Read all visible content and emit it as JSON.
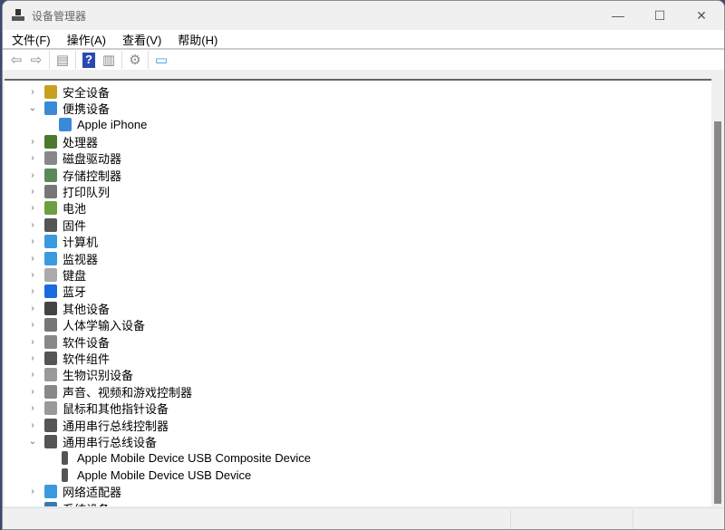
{
  "window": {
    "title": "设备管理器",
    "minimize": "—",
    "maximize": "☐",
    "close": "✕"
  },
  "menu": [
    "文件(F)",
    "操作(A)",
    "查看(V)",
    "帮助(H)"
  ],
  "toolbar": [
    {
      "icon": "back-icon",
      "glyph": "⇦"
    },
    {
      "icon": "forward-icon",
      "glyph": "⇨"
    },
    {
      "icon": "show-hide-console-tree-icon",
      "glyph": "▤"
    },
    {
      "icon": "help-icon",
      "glyph": "?"
    },
    {
      "icon": "properties-pane-icon",
      "glyph": "▥"
    },
    {
      "icon": "update-driver-icon",
      "glyph": "⚙"
    },
    {
      "icon": "scan-hardware-icon",
      "glyph": "▭"
    }
  ],
  "tree": [
    {
      "label": "安全设备",
      "level": 0,
      "expanded": false,
      "color": "#c8a020"
    },
    {
      "label": "便携设备",
      "level": 0,
      "expanded": true,
      "color": "#3a8ad8"
    },
    {
      "label": "Apple iPhone",
      "level": 1,
      "color": "#3a8ad8"
    },
    {
      "label": "处理器",
      "level": 0,
      "expanded": false,
      "color": "#4a7a2a"
    },
    {
      "label": "磁盘驱动器",
      "level": 0,
      "expanded": false,
      "color": "#888888"
    },
    {
      "label": "存储控制器",
      "level": 0,
      "expanded": false,
      "color": "#5a8a5a"
    },
    {
      "label": "打印队列",
      "level": 0,
      "expanded": false,
      "color": "#777777"
    },
    {
      "label": "电池",
      "level": 0,
      "expanded": false,
      "color": "#6aa040"
    },
    {
      "label": "固件",
      "level": 0,
      "expanded": false,
      "color": "#555555"
    },
    {
      "label": "计算机",
      "level": 0,
      "expanded": false,
      "color": "#3a9ae0"
    },
    {
      "label": "监视器",
      "level": 0,
      "expanded": false,
      "color": "#3a9ae0"
    },
    {
      "label": "键盘",
      "level": 0,
      "expanded": false,
      "color": "#aaaaaa"
    },
    {
      "label": "蓝牙",
      "level": 0,
      "expanded": false,
      "color": "#1a6ae0"
    },
    {
      "label": "其他设备",
      "level": 0,
      "expanded": false,
      "color": "#444444"
    },
    {
      "label": "人体学输入设备",
      "level": 0,
      "expanded": false,
      "color": "#777777"
    },
    {
      "label": "软件设备",
      "level": 0,
      "expanded": false,
      "color": "#888888"
    },
    {
      "label": "软件组件",
      "level": 0,
      "expanded": false,
      "color": "#555555"
    },
    {
      "label": "生物识别设备",
      "level": 0,
      "expanded": false,
      "color": "#999999"
    },
    {
      "label": "声音、视频和游戏控制器",
      "level": 0,
      "expanded": false,
      "color": "#888888"
    },
    {
      "label": "鼠标和其他指针设备",
      "level": 0,
      "expanded": false,
      "color": "#999999"
    },
    {
      "label": "通用串行总线控制器",
      "level": 0,
      "expanded": false,
      "color": "#555555"
    },
    {
      "label": "通用串行总线设备",
      "level": 0,
      "expanded": true,
      "color": "#555555"
    },
    {
      "label": "Apple Mobile Device USB Composite Device",
      "level": 1,
      "color": "#555555"
    },
    {
      "label": "Apple Mobile Device USB Device",
      "level": 1,
      "color": "#555555"
    },
    {
      "label": "网络适配器",
      "level": 0,
      "expanded": false,
      "color": "#3a9ae0"
    },
    {
      "label": "系统设备",
      "level": 0,
      "expanded": false,
      "color": "#3a7ab0"
    }
  ]
}
